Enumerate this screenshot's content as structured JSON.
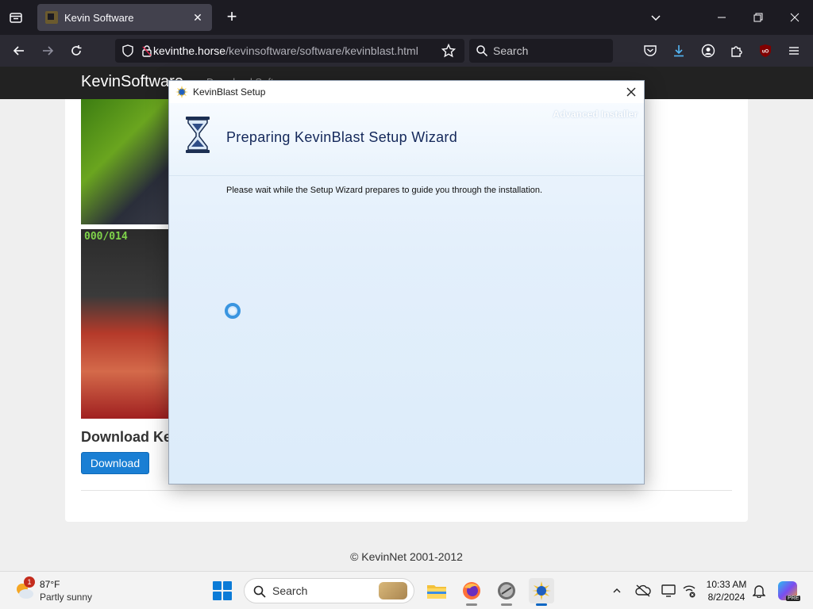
{
  "browser": {
    "tab_title": "Kevin Software",
    "url_host": "kevinthe.horse",
    "url_path": "/kevinsoftware/software/kevinblast.html",
    "search_placeholder": "Search"
  },
  "site": {
    "brand": "KevinSoftware",
    "nav_partial": "Download Software",
    "screenshot_counter": "000/014",
    "download_heading": "Download KevinBlast",
    "download_button": "Download",
    "footer": "© KevinNet 2001-2012"
  },
  "dialog": {
    "title": "KevinBlast Setup",
    "watermark": "Advanced Installer",
    "heading": "Preparing KevinBlast Setup Wizard",
    "message": "Please wait while the Setup Wizard prepares to guide you through the installation."
  },
  "taskbar": {
    "weather_temp": "87°F",
    "weather_desc": "Partly sunny",
    "weather_badge": "1",
    "search_label": "Search",
    "time": "10:33 AM",
    "date": "8/2/2024",
    "copilot_tag": "PRE"
  },
  "colors": {
    "accent": "#1a7fd4",
    "browser_dark": "#1c1b22",
    "dialog_heading": "#14285a"
  }
}
